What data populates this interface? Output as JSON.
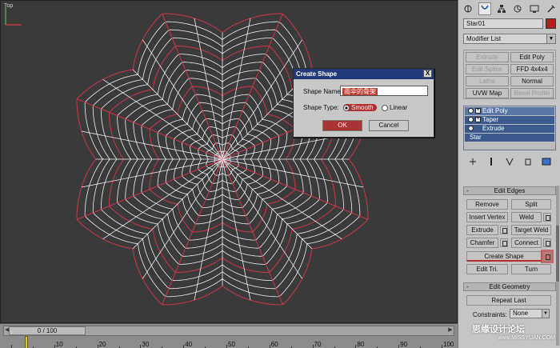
{
  "viewport": {
    "label": "Top"
  },
  "timeline": {
    "frame_readout": "0 / 100",
    "ticks": [
      "10",
      "20",
      "30",
      "40",
      "50",
      "60",
      "70",
      "80",
      "90",
      "100"
    ]
  },
  "panel": {
    "tabs": [
      "create-icon",
      "modify-icon",
      "hierarchy-icon",
      "motion-icon",
      "display-icon",
      "utilities-icon"
    ],
    "object_name": "Star01",
    "object_color": "#b41e1e",
    "modifier_list": "Modifier List",
    "mod_buttons": [
      {
        "label": "Extrude",
        "enabled": false
      },
      {
        "label": "Edit Poly",
        "enabled": true
      },
      {
        "label": "Edit Spline",
        "enabled": false
      },
      {
        "label": "FFD 4x4x4",
        "enabled": true
      },
      {
        "label": "Lathe",
        "enabled": false
      },
      {
        "label": "Normal",
        "enabled": true
      },
      {
        "label": "UVW Map",
        "enabled": true
      },
      {
        "label": "Bevel Profile",
        "enabled": false
      }
    ],
    "stack": [
      "Edit Poly",
      "Taper",
      "Extrude",
      "Star"
    ],
    "edit_edges": {
      "title": "Edit Edges",
      "remove": "Remove",
      "split": "Split",
      "insert_vertex": "Insert Vertex",
      "weld": "Weld",
      "extrude": "Extrude",
      "target_weld": "Target Weld",
      "chamfer": "Chamfer",
      "connect": "Connect",
      "create_shape": "Create Shape",
      "edit_tri": "Edit Tri.",
      "turn": "Turn"
    },
    "edit_geometry": {
      "title": "Edit Geometry",
      "repeat_last": "Repeat Last",
      "constraints_label": "Constraints:",
      "constraints_value": "None"
    }
  },
  "dialog": {
    "title": "Create Shape",
    "close": "X",
    "name_label": "Shape Name:",
    "name_value": "雨伞的骨架",
    "type_label": "Shape Type:",
    "smooth": "Smooth",
    "linear": "Linear",
    "ok": "OK",
    "cancel": "Cancel"
  },
  "watermark": {
    "text": "思缘设计论坛",
    "site": "www.MISSYUAN.COM"
  }
}
